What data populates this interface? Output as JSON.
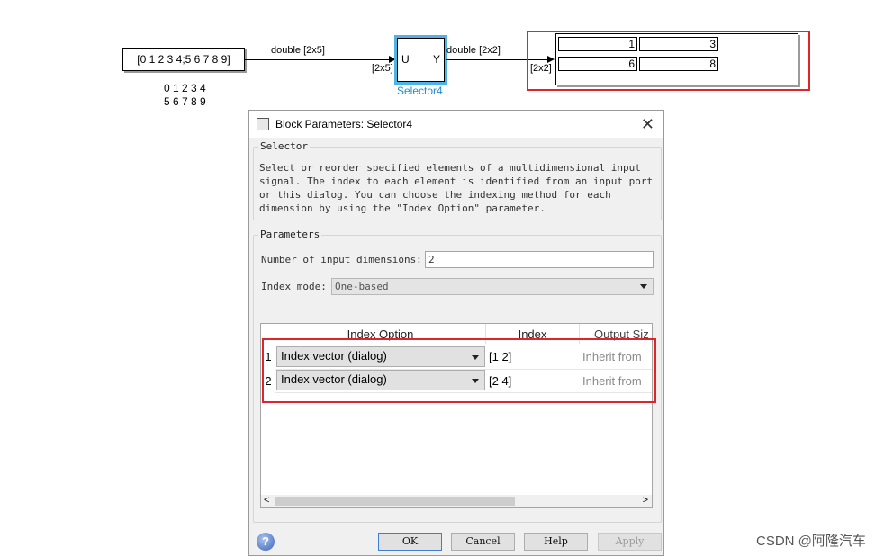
{
  "canvas": {
    "constant_value": "[0 1 2 3 4;5 6 7 8 9]",
    "constant_note_line1": "0 1 2 3 4",
    "constant_note_line2": "5 6 7 8 9",
    "signal1_label": "double [2x5]",
    "port_in_dim": "[2x5]",
    "selector_in_port": "U",
    "selector_out_port": "Y",
    "selector_name": "Selector4",
    "signal2_label": "double [2x2]",
    "display_in_dim": "[2x2]",
    "display_values": [
      "1",
      "3",
      "6",
      "8"
    ]
  },
  "dialog": {
    "title": "Block Parameters: Selector4",
    "close": "✕",
    "selector_group_title": "Selector",
    "description_lines": [
      "Select or reorder specified elements of a multidimensional input",
      "signal. The index to each element is identified from an input port",
      "or this dialog. You can choose the indexing method for each",
      "dimension by using the \"Index Option\" parameter."
    ],
    "params_group_title": "Parameters",
    "num_dims_label": "Number of input dimensions:",
    "num_dims_value": "2",
    "index_mode_label": "Index mode:",
    "index_mode_value": "One-based",
    "table": {
      "headers": [
        "Index Option",
        "Index",
        "Output Siz"
      ],
      "rows": [
        {
          "num": "1",
          "option": "Index vector (dialog)",
          "index": "[1 2]",
          "output_size": "Inherit from"
        },
        {
          "num": "2",
          "option": "Index vector (dialog)",
          "index": "[2 4]",
          "output_size": "Inherit from"
        }
      ]
    },
    "scroll_left": "<",
    "scroll_right": ">",
    "buttons": {
      "ok": "OK",
      "cancel": "Cancel",
      "help": "Help",
      "apply": "Apply"
    },
    "help_icon": "?"
  },
  "watermark": "CSDN @阿隆汽车",
  "colors": {
    "highlight_red": "#e0242c",
    "selected_blue": "#4fb3e8",
    "name_blue": "#1e8bd6"
  }
}
